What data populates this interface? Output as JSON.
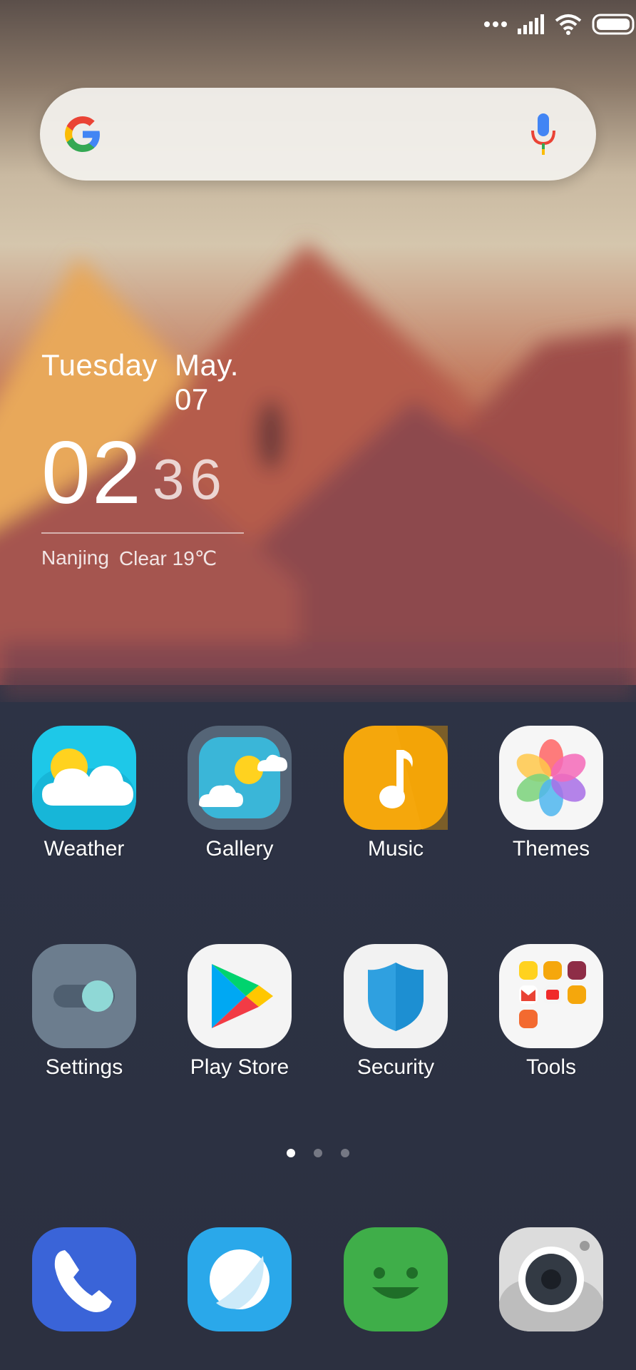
{
  "status_bar": {
    "icons": [
      "more-dots-icon",
      "signal-icon",
      "wifi-icon",
      "battery-icon"
    ]
  },
  "search": {
    "logo": "google-g-icon",
    "mic": "mic-icon"
  },
  "clock": {
    "day": "Tuesday",
    "date": "May. 07",
    "hour": "02",
    "minute": "36",
    "city": "Nanjing",
    "weather": "Clear 19℃"
  },
  "apps": [
    {
      "label": "Weather",
      "icon": "weather-icon"
    },
    {
      "label": "Gallery",
      "icon": "gallery-icon"
    },
    {
      "label": "Music",
      "icon": "music-icon"
    },
    {
      "label": "Themes",
      "icon": "themes-icon"
    },
    {
      "label": "Settings",
      "icon": "settings-icon"
    },
    {
      "label": "Play Store",
      "icon": "play-store-icon"
    },
    {
      "label": "Security",
      "icon": "security-icon"
    },
    {
      "label": "Tools",
      "icon": "tools-folder-icon"
    }
  ],
  "page_indicator": {
    "pages": 3,
    "active": 1
  },
  "dock": [
    {
      "icon": "phone-icon"
    },
    {
      "icon": "browser-icon"
    },
    {
      "icon": "messaging-icon"
    },
    {
      "icon": "camera-icon"
    }
  ],
  "colors": {
    "sky": "#7b6a5c",
    "mountain": "#b0594e",
    "bottom": "#2e3546",
    "accent_blue": "#2fa0e0"
  }
}
